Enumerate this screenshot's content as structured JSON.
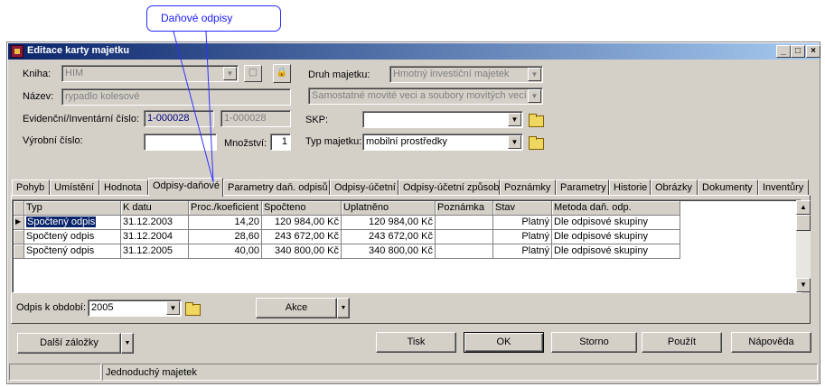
{
  "callout": {
    "text": "Daňové odpisy"
  },
  "window": {
    "title": "Editace karty majetku",
    "controls": {
      "minimize": "_",
      "maximize": "□",
      "close": "×"
    }
  },
  "form": {
    "kniha": {
      "label": "Kniha:",
      "value": "HIM"
    },
    "nazev": {
      "label": "Název:",
      "value": "rypadlo kolesové"
    },
    "evidencni": {
      "label": "Evidenční/Inventární číslo:",
      "value1": "1-000028",
      "value2": "1-000028"
    },
    "vyrobni": {
      "label": "Výrobní číslo:",
      "value": ""
    },
    "mnozstvi": {
      "label": "Množství:",
      "value": "1"
    },
    "druh": {
      "label": "Druh majetku:",
      "value1": "Hmotný investiční majetek",
      "value2": "Samostatné movité veci a soubory movitých vecí"
    },
    "skp": {
      "label": "SKP:",
      "value": ""
    },
    "typ": {
      "label": "Typ majetku:",
      "value": "mobilní prostředky"
    }
  },
  "tabs": [
    "Pohyb",
    "Umístění",
    "Hodnota",
    "Odpisy-daňové",
    "Parametry daň. odpisů",
    "Odpisy-účetní",
    "Odpisy-účetní způsob",
    "Poznámky",
    "Parametry",
    "Historie",
    "Obrázky",
    "Dokumenty",
    "Inventůry"
  ],
  "grid": {
    "columns": [
      "Typ",
      "K datu",
      "Proc./koeficient",
      "Spočteno",
      "Uplatněno",
      "Poznámka",
      "Stav",
      "Metoda daň. odp."
    ],
    "rows": [
      [
        "Spočtený odpis",
        "31.12.2003",
        "14,20",
        "120 984,00 Kč",
        "120 984,00 Kč",
        "",
        "Platný",
        "Dle odpisové skupiny"
      ],
      [
        "Spočtený odpis",
        "31.12.2004",
        "28,60",
        "243 672,00 Kč",
        "243 672,00 Kč",
        "",
        "Platný",
        "Dle odpisové skupiny"
      ],
      [
        "Spočtený odpis",
        "31.12.2005",
        "40,00",
        "340 800,00 Kč",
        "340 800,00 Kč",
        "",
        "Platný",
        "Dle odpisové skupiny"
      ]
    ]
  },
  "odpis_obdobi": {
    "label": "Odpis k období:",
    "value": "2005"
  },
  "akce": {
    "label": "Akce"
  },
  "buttons": {
    "dalsi": "Další záložky",
    "tisk": "Tisk",
    "ok": "OK",
    "storno": "Storno",
    "pouzit": "Použít",
    "napoveda": "Nápověda"
  },
  "status": {
    "text": "Jednoduchý majetek"
  },
  "icons": {
    "dropdown": "▼",
    "scroll_up": "▲",
    "scroll_down": "▼",
    "row_indicator": "▶",
    "lock": "🔒"
  }
}
